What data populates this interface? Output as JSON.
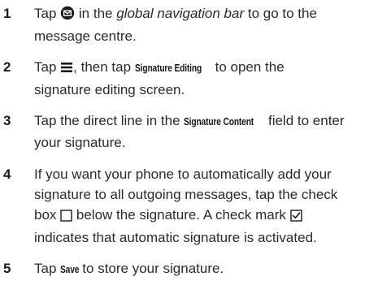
{
  "steps": [
    {
      "number": "1",
      "pre": "Tap",
      "icon": "message-centre-icon",
      "mid": "in the",
      "italic": "global navigation bar",
      "post_line1": "to go to the",
      "line2": "message centre."
    },
    {
      "number": "2",
      "pre": "Tap",
      "icon": "menu-icon",
      "mid": ", then tap",
      "ui_label": "Signature Editing",
      "post_line1": "to open the",
      "line2": "signature editing screen."
    },
    {
      "number": "3",
      "pre": "Tap the direct line in the",
      "ui_label": "Signature Content",
      "post_line1": "field to enter",
      "line2": "your signature."
    },
    {
      "number": "4",
      "line1": "If you want your phone to automatically add your",
      "line2": "signature to all outgoing messages, tap the check",
      "line3_pre": "box",
      "icon_unchecked": "empty-checkbox-icon",
      "line3_mid": "below the signature. A check mark",
      "icon_checked": "checked-checkbox-icon",
      "line4": "indicates that automatic signature is activated."
    },
    {
      "number": "5",
      "pre": "Tap",
      "ui_label": "Save",
      "post": "to store your signature."
    }
  ]
}
